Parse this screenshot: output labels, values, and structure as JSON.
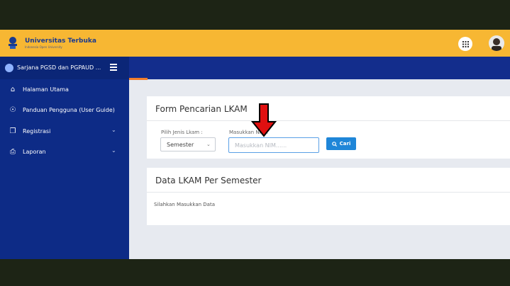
{
  "header": {
    "brand_name": "Universitas Terbuka",
    "brand_sub": "Indonesia Open University",
    "apps_icon": "grid-icon",
    "avatar_icon": "user-avatar"
  },
  "sidebar": {
    "program": "Sarjana PGSD dan PGPAUD ...",
    "items": [
      {
        "label": "Halaman Utama",
        "icon": "home-icon"
      },
      {
        "label": "Panduan Pengguna (User Guide)",
        "icon": "compass-icon"
      },
      {
        "label": "Registrasi",
        "icon": "copy-icon",
        "has_submenu": true
      },
      {
        "label": "Laporan",
        "icon": "print-icon",
        "has_submenu": true
      }
    ]
  },
  "search_form": {
    "title": "Form Pencarian LKAM",
    "type_label": "Pilih Jenis Lkam :",
    "type_value": "Semester",
    "nim_label": "Masukkan NIM :",
    "nim_placeholder": "Masukkan NIM......",
    "search_button": "Cari"
  },
  "results": {
    "title": "Data LKAM Per Semester",
    "empty_message": "Silahkan Masukkan Data"
  },
  "colors": {
    "topbar": "#f7b733",
    "sidebar": "#0d2b86",
    "accent": "#f47d2a",
    "button": "#1f86d8",
    "annotation_arrow": "#e01010"
  }
}
